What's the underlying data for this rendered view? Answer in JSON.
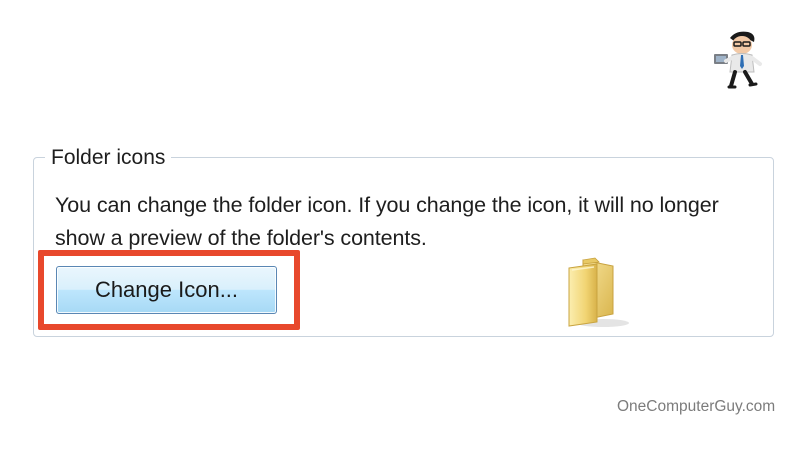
{
  "group": {
    "title": "Folder icons",
    "description": "You can change the folder icon. If you change the icon, it will no longer show a preview of the folder's contents."
  },
  "button": {
    "label": "Change Icon..."
  },
  "highlight_color": "#e8482c",
  "icons": {
    "logo": "onecomputerguy-mascot-logo",
    "folder": "folder-icon"
  },
  "watermark": "OneComputerGuy.com"
}
